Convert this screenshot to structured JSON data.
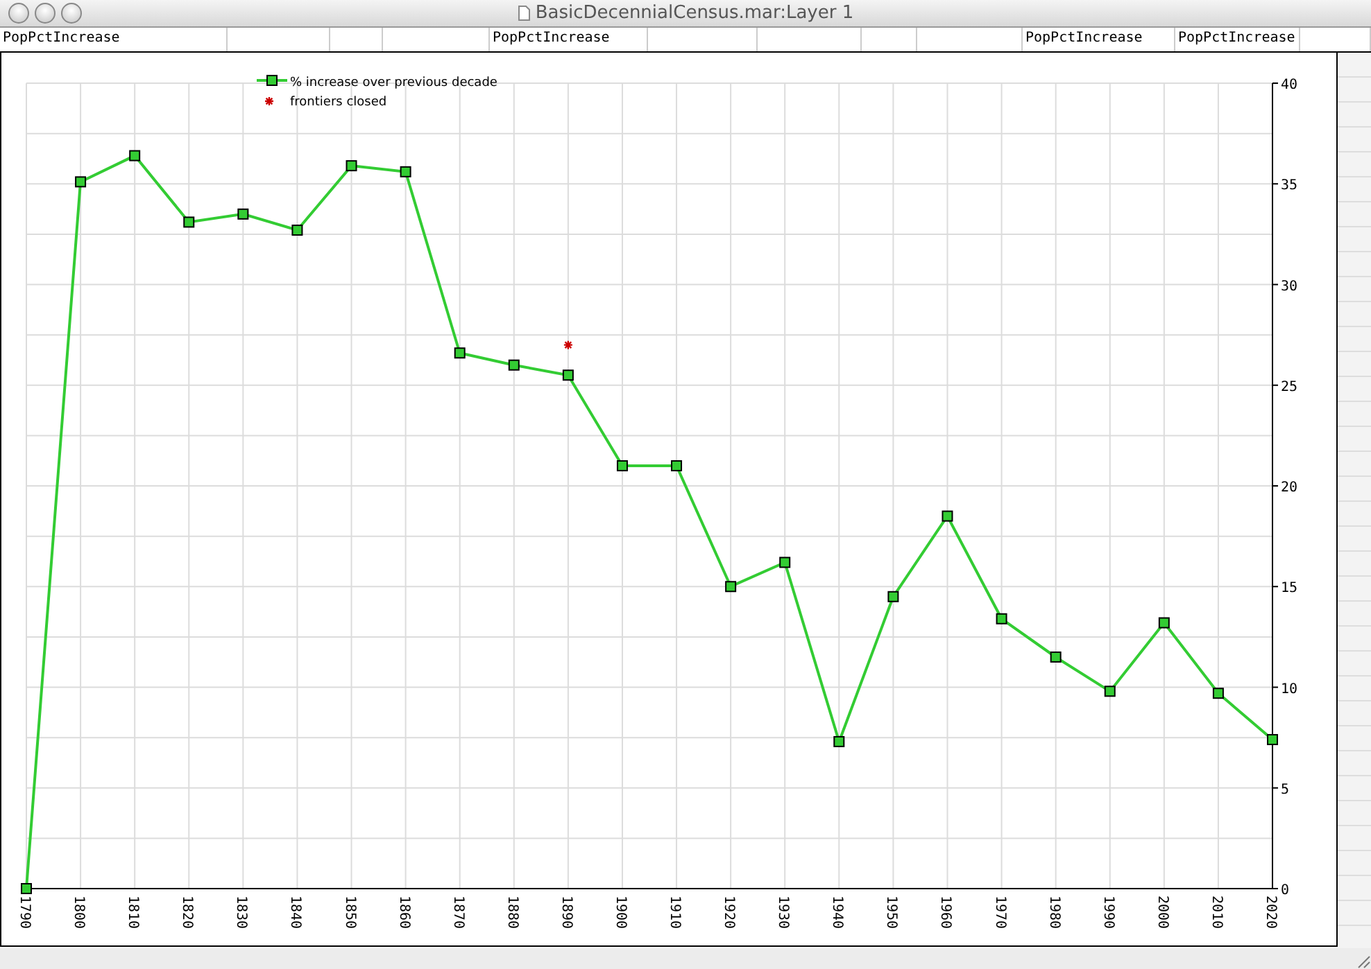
{
  "window": {
    "title": "BasicDecennialCensus.mar:Layer 1"
  },
  "header_cells": [
    {
      "label": "PopPctIncrease"
    },
    {},
    {},
    {},
    {
      "label": "PopPctIncrease"
    },
    {},
    {},
    {},
    {},
    {
      "label": "PopPctIncrease"
    },
    {
      "label": "PopPctIncrease"
    },
    {}
  ],
  "chart": {
    "chart_data": {
      "type": "line",
      "categories": [
        "1790",
        "1800",
        "1810",
        "1820",
        "1830",
        "1840",
        "1850",
        "1860",
        "1870",
        "1880",
        "1890",
        "1900",
        "1910",
        "1920",
        "1930",
        "1940",
        "1950",
        "1960",
        "1970",
        "1980",
        "1990",
        "2000",
        "2010",
        "2020"
      ],
      "ylim": [
        0,
        40
      ],
      "yticks": [
        0,
        5,
        10,
        15,
        20,
        25,
        30,
        35,
        40
      ],
      "grid": true,
      "legend": true,
      "series": [
        {
          "name": "% increase over previous decade",
          "color": "#33cc33",
          "marker": "square",
          "values": [
            0,
            35.1,
            36.4,
            33.1,
            33.5,
            32.7,
            35.9,
            35.6,
            26.6,
            26.0,
            25.5,
            21.0,
            21.0,
            15.0,
            16.2,
            7.3,
            14.5,
            18.5,
            13.4,
            11.5,
            9.8,
            13.2,
            9.7,
            7.4
          ]
        },
        {
          "name": "frontiers closed",
          "color": "#cc0000",
          "marker": "cross",
          "values": [
            null,
            null,
            null,
            null,
            null,
            null,
            null,
            null,
            null,
            null,
            27.0,
            null,
            null,
            null,
            null,
            null,
            null,
            null,
            null,
            null,
            null,
            null,
            null,
            null
          ]
        }
      ]
    }
  }
}
